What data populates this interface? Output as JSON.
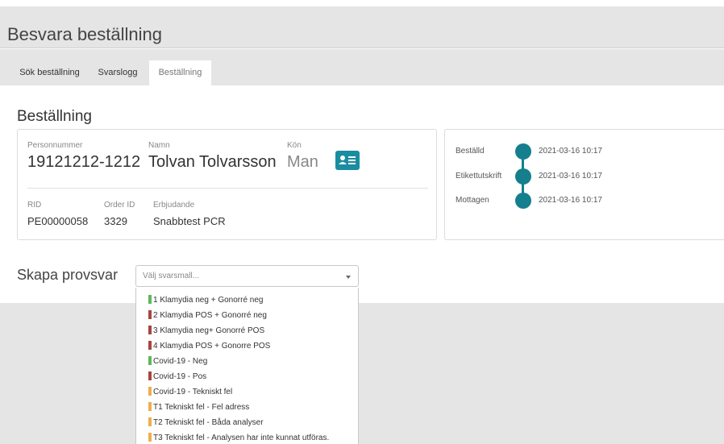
{
  "header": {
    "title": "Besvara beställning"
  },
  "tabs": [
    {
      "label": "Sök beställning"
    },
    {
      "label": "Svarslogg"
    },
    {
      "label": "Beställning"
    }
  ],
  "order": {
    "section_title": "Beställning",
    "personnummer_label": "Personnummer",
    "personnummer": "19121212-1212",
    "namn_label": "Namn",
    "namn": "Tolvan Tolvarsson",
    "kon_label": "Kön",
    "kon": "Man",
    "rid_label": "RID",
    "rid": "PE00000058",
    "order_id_label": "Order ID",
    "order_id": "3329",
    "erbjudande_label": "Erbjudande",
    "erbjudande": "Snabbtest PCR"
  },
  "timeline": [
    {
      "label": "Beställd",
      "date": "2021-03-16 10:17"
    },
    {
      "label": "Etikettutskrift",
      "date": "2021-03-16 10:17"
    },
    {
      "label": "Mottagen",
      "date": "2021-03-16 10:17"
    }
  ],
  "provsvar": {
    "title": "Skapa provsvar",
    "placeholder": "Välj svarsmall...",
    "options": [
      {
        "label": "1 Klamydia neg + Gonorré neg",
        "color": "#5cb85c"
      },
      {
        "label": "2 Klamydia POS + Gonorré neg",
        "color": "#a94442"
      },
      {
        "label": "3 Klamydia neg+ Gonorré POS",
        "color": "#a94442"
      },
      {
        "label": "4 Klamydia POS + Gonorre POS",
        "color": "#a94442"
      },
      {
        "label": "Covid-19 - Neg",
        "color": "#5cb85c"
      },
      {
        "label": "Covid-19 - Pos",
        "color": "#a94442"
      },
      {
        "label": "Covid-19 - Tekniskt fel",
        "color": "#f0ad4e"
      },
      {
        "label": "T1 Tekniskt fel - Fel adress",
        "color": "#f0ad4e"
      },
      {
        "label": "T2 Tekniskt fel - Båda analyser",
        "color": "#f0ad4e"
      },
      {
        "label": "T3 Tekniskt fel - Analysen har inte kunnat utföras.",
        "color": "#f0ad4e"
      }
    ]
  },
  "colors": {
    "accent": "#157f8d",
    "header_bg": "#e5e5e5"
  }
}
